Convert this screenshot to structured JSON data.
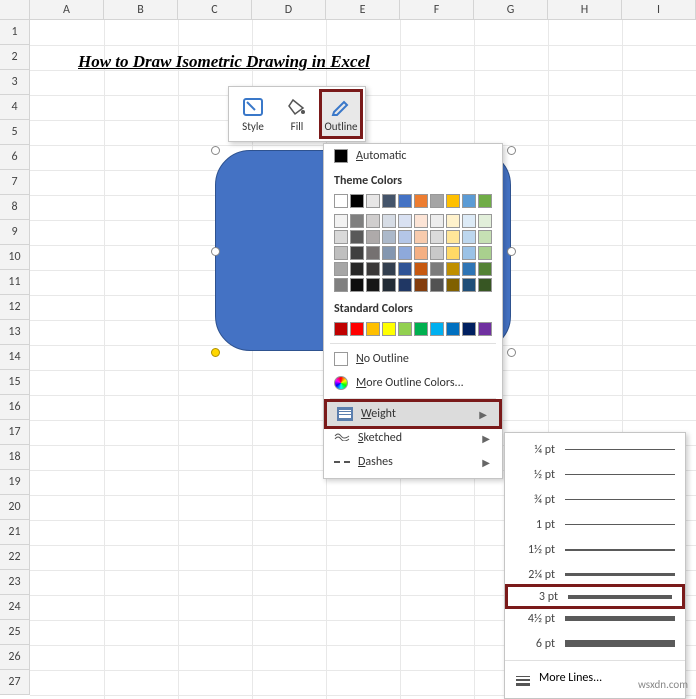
{
  "columns": [
    "A",
    "B",
    "C",
    "D",
    "E",
    "F",
    "G",
    "H",
    "I"
  ],
  "row_count": 27,
  "title": "How to Draw Isometric Drawing in Excel",
  "mini_toolbar": {
    "style": "Style",
    "fill": "Fill",
    "outline": "Outline"
  },
  "outline_menu": {
    "automatic": "Automatic",
    "theme_label": "Theme Colors",
    "theme_row1": [
      "#ffffff",
      "#000000",
      "#e7e6e6",
      "#44546a",
      "#4472c4",
      "#ed7d31",
      "#a5a5a5",
      "#ffc000",
      "#5b9bd5",
      "#70ad47"
    ],
    "theme_shades": [
      [
        "#f2f2f2",
        "#7f7f7f",
        "#d0cece",
        "#d6dce5",
        "#d9e1f2",
        "#fce4d6",
        "#ededed",
        "#fff2cc",
        "#ddebf7",
        "#e2efda"
      ],
      [
        "#d9d9d9",
        "#595959",
        "#aeaaaa",
        "#acb9ca",
        "#b4c6e7",
        "#f8cbad",
        "#dbdbdb",
        "#ffe699",
        "#bdd7ee",
        "#c6e0b4"
      ],
      [
        "#bfbfbf",
        "#404040",
        "#757171",
        "#8497b0",
        "#8ea9db",
        "#f4b084",
        "#c9c9c9",
        "#ffd966",
        "#9bc2e6",
        "#a9d08e"
      ],
      [
        "#a6a6a6",
        "#262626",
        "#3a3838",
        "#333f4f",
        "#305496",
        "#c65911",
        "#7b7b7b",
        "#bf8f00",
        "#2f75b5",
        "#548235"
      ],
      [
        "#808080",
        "#0d0d0d",
        "#161616",
        "#222b35",
        "#203764",
        "#833c0c",
        "#525252",
        "#806000",
        "#1f4e78",
        "#375623"
      ]
    ],
    "standard_label": "Standard Colors",
    "standard": [
      "#c00000",
      "#ff0000",
      "#ffc000",
      "#ffff00",
      "#92d050",
      "#00b050",
      "#00b0f0",
      "#0070c0",
      "#002060",
      "#7030a0"
    ],
    "no_outline": "No Outline",
    "more_colors": "More Outline Colors...",
    "weight": "Weight",
    "sketched": "Sketched",
    "dashes": "Dashes"
  },
  "weight_menu": {
    "items": [
      {
        "label": "¼ pt",
        "thickness": 0.5
      },
      {
        "label": "½ pt",
        "thickness": 1
      },
      {
        "label": "¾ pt",
        "thickness": 1
      },
      {
        "label": "1 pt",
        "thickness": 1.5
      },
      {
        "label": "1½ pt",
        "thickness": 2
      },
      {
        "label": "2¼ pt",
        "thickness": 3
      },
      {
        "label": "3 pt",
        "thickness": 4
      },
      {
        "label": "4½ pt",
        "thickness": 5.5
      },
      {
        "label": "6 pt",
        "thickness": 7
      }
    ],
    "more": "More Lines..."
  },
  "watermark": "wsxdn.com"
}
